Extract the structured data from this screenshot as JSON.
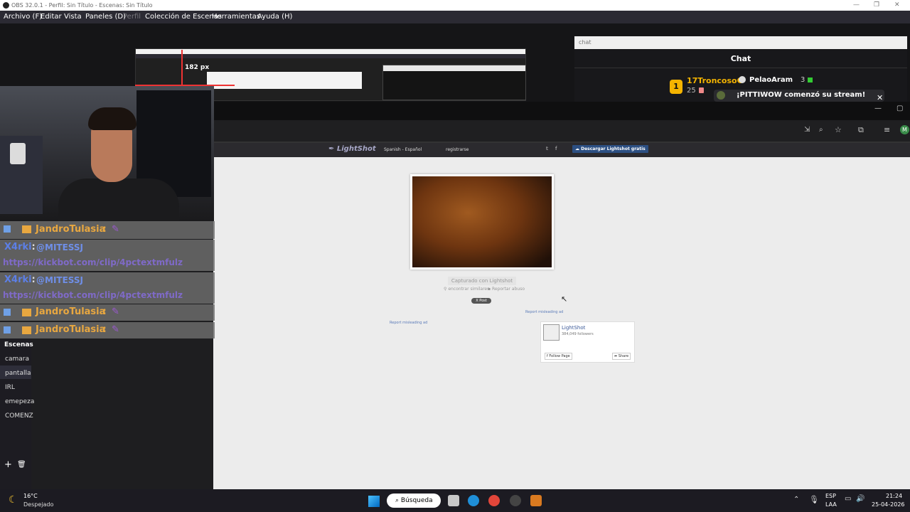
{
  "obs": {
    "title": "OBS 32.0.1 - Perfil: Sin Título - Escenas: Sin Título",
    "menu": [
      "Archivo (F)",
      "Editar",
      "Vista",
      "Paneles (D)",
      "Perfil",
      "Colección de Escenas",
      "Herramientas",
      "Ayuda (H)"
    ]
  },
  "preview": {
    "measure_label": "182 px"
  },
  "chat_dock": {
    "url_text": "chat",
    "title": "Chat",
    "user1": "17TroncosoC",
    "user1_count": "25",
    "user2": "PelaoAram",
    "user2_count": "3",
    "badge1": "1",
    "stream_msg": "¡PITTIWOW comenzó su stream!"
  },
  "lightshot": {
    "language": "Spanish - Español",
    "register": "registrarse",
    "download_button": "Descargar Lightshot gratis",
    "captured": "Capturado con Lightshot",
    "find_similar": "encontrar similares",
    "report_abuse": "Reportar abuso",
    "post_button": "X Post",
    "report_ad_1": "Report misleading ad",
    "report_ad_2": "Report misleading ad",
    "fb_name": "LightShot",
    "fb_followers": "384,049 followers",
    "fb_follow": "Follow Page",
    "fb_share": "Share"
  },
  "overlay_chat": [
    {
      "name": "JandroTulasia",
      "sep": " : "
    },
    {
      "name": "X4rki",
      "sep": " : ",
      "mention": "@MITESSJ",
      "link": "https://kickbot.com/clip/4pctextmfulz"
    },
    {
      "name": "X4rki",
      "sep": " : ",
      "mention": "@MITESSJ",
      "link": "https://kickbot.com/clip/4pctextmfulz"
    },
    {
      "name": "JandroTulasia",
      "sep": " : "
    },
    {
      "name": "JandroTulasia",
      "sep": " : "
    }
  ],
  "scenes": {
    "header": "Escenas",
    "items": [
      "camara",
      "pantalla",
      "IRL",
      "emepeza",
      "COMENZ"
    ],
    "selected": "pantalla"
  },
  "taskbar": {
    "temp": "16°C",
    "weather": "Despejado",
    "search": "Búsqueda",
    "lang1": "ESP",
    "lang2": "LAA",
    "time": "21:24",
    "date": "25-04-2026"
  },
  "colors": {
    "accent": "#2c4f82",
    "overlay_name": "#e8a740",
    "overlay_blue": "#5c7fe6"
  }
}
